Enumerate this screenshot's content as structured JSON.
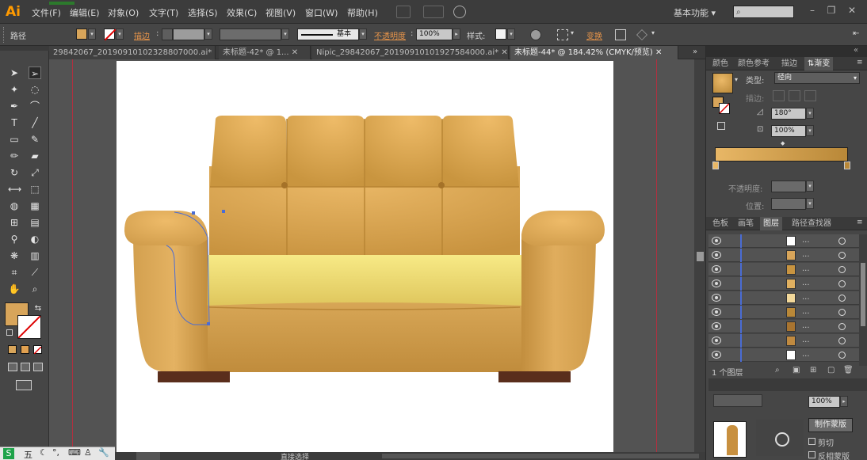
{
  "app": {
    "logo": "Ai"
  },
  "menu": [
    "文件(F)",
    "编辑(E)",
    "对象(O)",
    "文字(T)",
    "选择(S)",
    "效果(C)",
    "视图(V)",
    "窗口(W)",
    "帮助(H)"
  ],
  "workspace": "基本功能",
  "control_bar": {
    "selection_label": "路径",
    "stroke_label": "描边",
    "stroke_profile": "基本",
    "opacity_label": "不透明度",
    "opacity_value": "100%",
    "style_label": "样式",
    "transform_label": "变换",
    "colors": {
      "fill": "#d8a55a",
      "accent_label": "#e8954a"
    }
  },
  "tabs": [
    {
      "label": "29842067_20190910102328807000.ai*",
      "active": false
    },
    {
      "label": "未标题-42* @ 1...",
      "active": false
    },
    {
      "label": "Nipic_29842067_20190910101927584000.ai*",
      "active": false
    },
    {
      "label": "未标题-44* @ 184.42% (CMYK/预览)",
      "active": true
    }
  ],
  "tools": [
    [
      "selection-arrow-icon",
      "direct-selection-icon"
    ],
    [
      "magic-wand-icon",
      "lasso-icon"
    ],
    [
      "pen-icon",
      "curvature-icon"
    ],
    [
      "type-icon",
      "line-segment-icon"
    ],
    [
      "rectangle-icon",
      "paintbrush-icon"
    ],
    [
      "pencil-icon",
      "eraser-icon"
    ],
    [
      "rotate-icon",
      "scale-icon"
    ],
    [
      "width-icon",
      "free-transform-icon"
    ],
    [
      "shape-builder-icon",
      "perspective-grid-icon"
    ],
    [
      "mesh-icon",
      "gradient-icon"
    ],
    [
      "eyedropper-icon",
      "blend-icon"
    ],
    [
      "symbol-sprayer-icon",
      "column-graph-icon"
    ],
    [
      "artboard-icon",
      "slice-icon"
    ],
    [
      "hand-icon",
      "zoom-icon"
    ]
  ],
  "gradient_panel": {
    "tabs": [
      "颜色",
      "颜色参考",
      "描边",
      "渐变"
    ],
    "active_tab": "渐变",
    "type_label": "类型",
    "type_value": "径向",
    "stroke_label": "描边",
    "angle": "180°",
    "aspect": "100%",
    "opacity_label": "不透明度",
    "position_label": "位置",
    "colors": {
      "start": "#e8b766",
      "end": "#b98838"
    }
  },
  "layers_panel": {
    "tabs": [
      "色板",
      "画笔",
      "图层",
      "路径查找器"
    ],
    "active_tab": "图层",
    "row_dots": "...",
    "footer": "1 个图层",
    "rows": [
      {
        "thumb": "#ffffff"
      },
      {
        "thumb": "#d8a55a"
      },
      {
        "thumb": "#c89440"
      },
      {
        "thumb": "#e0b060"
      },
      {
        "thumb": "#f2d89a"
      },
      {
        "thumb": "#b98838"
      },
      {
        "thumb": "#a87430"
      },
      {
        "thumb": "#c08a40"
      },
      {
        "thumb": "#ffffff"
      }
    ]
  },
  "transparency_panel": {
    "opacity": "100%",
    "make_mask_button": "制作蒙版",
    "clip_label": "剪切",
    "invert_label": "反相蒙版"
  },
  "status_bar": {
    "tool_name": "直接选择"
  },
  "taskbar": {
    "ime": "五"
  },
  "colors": {
    "sofa_light": "#eab665",
    "sofa_mid": "#d6a253",
    "sofa_dark": "#b98536",
    "seat_light": "#f5e27a",
    "seat_dark": "#d8bf55",
    "legs": "#5a2e1c",
    "selection": "#4a6cd4"
  }
}
